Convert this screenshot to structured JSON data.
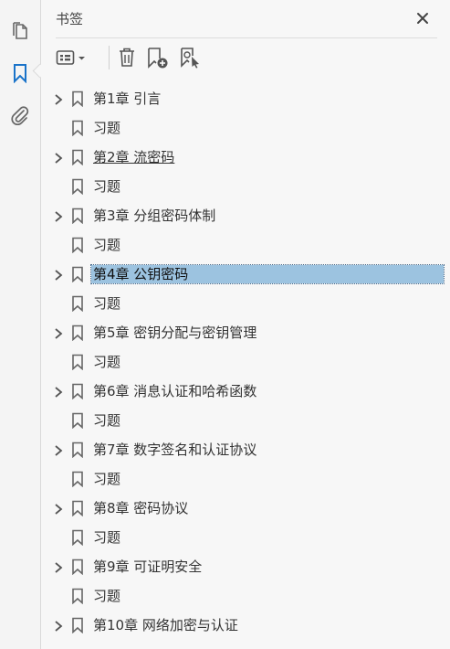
{
  "panel": {
    "title": "书签"
  },
  "rail": {
    "items": [
      {
        "name": "pages-icon"
      },
      {
        "name": "bookmark-icon"
      },
      {
        "name": "attachment-icon"
      }
    ]
  },
  "toolbar": {
    "buttons": [
      "options-menu-icon",
      "delete-icon",
      "new-bookmark-icon",
      "find-bookmark-icon"
    ]
  },
  "bookmarks": [
    {
      "label": "第1章 引言",
      "expandable": true
    },
    {
      "label": "习题",
      "expandable": false
    },
    {
      "label": "第2章 流密码",
      "expandable": true,
      "underline": true
    },
    {
      "label": "习题",
      "expandable": false
    },
    {
      "label": "第3章 分组密码体制",
      "expandable": true
    },
    {
      "label": "习题",
      "expandable": false
    },
    {
      "label": "第4章 公钥密码",
      "expandable": true,
      "selected": true
    },
    {
      "label": "习题",
      "expandable": false
    },
    {
      "label": "第5章 密钥分配与密钥管理",
      "expandable": true
    },
    {
      "label": "习题",
      "expandable": false
    },
    {
      "label": "第6章 消息认证和哈希函数",
      "expandable": true
    },
    {
      "label": "习题",
      "expandable": false
    },
    {
      "label": "第7章 数字签名和认证协议",
      "expandable": true
    },
    {
      "label": "习题",
      "expandable": false
    },
    {
      "label": "第8章 密码协议",
      "expandable": true
    },
    {
      "label": "习题",
      "expandable": false
    },
    {
      "label": "第9章 可证明安全",
      "expandable": true
    },
    {
      "label": "习题",
      "expandable": false
    },
    {
      "label": "第10章 网络加密与认证",
      "expandable": true
    }
  ],
  "colors": {
    "accent": "#1a73c9",
    "selection": "#9cc3e0"
  }
}
